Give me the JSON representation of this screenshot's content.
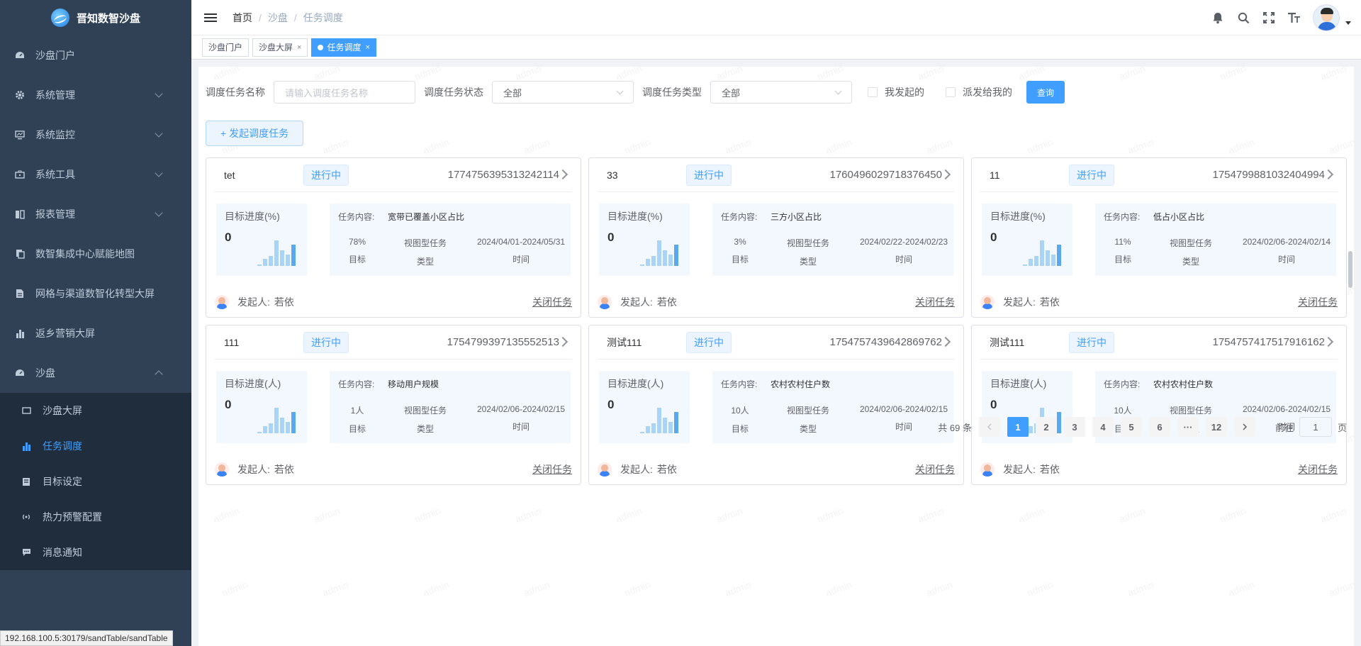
{
  "app": {
    "title": "晋知数智沙盘"
  },
  "sidebar": {
    "items": [
      {
        "label": "沙盘门户",
        "icon": "dashboard-icon",
        "expandable": false
      },
      {
        "label": "系统管理",
        "icon": "gear-icon",
        "expandable": true
      },
      {
        "label": "系统监控",
        "icon": "monitor-icon",
        "expandable": true
      },
      {
        "label": "系统工具",
        "icon": "toolbox-icon",
        "expandable": true
      },
      {
        "label": "报表管理",
        "icon": "book-icon",
        "expandable": true
      },
      {
        "label": "数智集成中心赋能地图",
        "icon": "clipboard-icon",
        "expandable": false
      },
      {
        "label": "网格与渠道数智化转型大屏",
        "icon": "document-icon",
        "expandable": false
      },
      {
        "label": "返乡营销大屏",
        "icon": "bar-chart-icon",
        "expandable": false
      },
      {
        "label": "沙盘",
        "icon": "dashboard-icon",
        "expandable": true,
        "open": true
      }
    ],
    "sub_items": [
      {
        "label": "沙盘大屏",
        "icon": "screen-icon",
        "active": false
      },
      {
        "label": "任务调度",
        "icon": "bar-chart-icon",
        "active": true
      },
      {
        "label": "目标设定",
        "icon": "target-doc-icon",
        "active": false
      },
      {
        "label": "热力预警配置",
        "icon": "broadcast-icon",
        "active": false
      },
      {
        "label": "消息通知",
        "icon": "chat-icon",
        "active": false
      }
    ]
  },
  "header": {
    "breadcrumb": [
      "首页",
      "沙盘",
      "任务调度"
    ],
    "icons": [
      "bell-icon",
      "search-icon",
      "fullscreen-icon",
      "font-size-icon"
    ]
  },
  "tags": [
    {
      "label": "沙盘门户",
      "closable": false,
      "active": false
    },
    {
      "label": "沙盘大屏",
      "closable": true,
      "active": false
    },
    {
      "label": "任务调度",
      "closable": true,
      "active": true
    }
  ],
  "filters": {
    "name_label": "调度任务名称",
    "name_placeholder": "请输入调度任务名称",
    "status_label": "调度任务状态",
    "status_value": "全部",
    "type_label": "调度任务类型",
    "type_value": "全部",
    "check_mine": "我发起的",
    "check_assigned": "派发给我的",
    "query_button": "查询"
  },
  "create_button": "+ 发起调度任务",
  "card_labels": {
    "content_key": "任务内容:",
    "target_key": "目标",
    "type_key": "类型",
    "time_key": "时间",
    "initiator_prefix": "发起人:",
    "close_task": "关闭任务"
  },
  "cards": [
    {
      "name": "tet",
      "status": "进行中",
      "id": "1774756395313242114",
      "progress_label": "目标进度(%)",
      "progress": "0",
      "content": "宽带已覆盖小区占比",
      "target": "78%",
      "type": "视图型任务",
      "time": "2024/04/01-2024/05/31",
      "initiator": "若依"
    },
    {
      "name": "33",
      "status": "进行中",
      "id": "1760496029718376450",
      "progress_label": "目标进度(%)",
      "progress": "0",
      "content": "三方小区占比",
      "target": "3%",
      "type": "视图型任务",
      "time": "2024/02/22-2024/02/23",
      "initiator": "若依"
    },
    {
      "name": "11",
      "status": "进行中",
      "id": "1754799881032404994",
      "progress_label": "目标进度(%)",
      "progress": "0",
      "content": "低占小区占比",
      "target": "11%",
      "type": "视图型任务",
      "time": "2024/02/06-2024/02/14",
      "initiator": "若依"
    },
    {
      "name": "111",
      "status": "进行中",
      "id": "1754799397135552513",
      "progress_label": "目标进度(人)",
      "progress": "0",
      "content": "移动用户规模",
      "target": "1人",
      "type": "视图型任务",
      "time": "2024/02/06-2024/02/15",
      "initiator": "若依"
    },
    {
      "name": "测试111",
      "status": "进行中",
      "id": "1754757439642869762",
      "progress_label": "目标进度(人)",
      "progress": "0",
      "content": "农村农村住户数",
      "target": "10人",
      "type": "视图型任务",
      "time": "2024/02/06-2024/02/15",
      "initiator": "若依"
    },
    {
      "name": "测试111",
      "status": "进行中",
      "id": "1754757417517916162",
      "progress_label": "目标进度(人)",
      "progress": "0",
      "content": "农村农村住户数",
      "target": "10人",
      "type": "视图型任务",
      "time": "2024/02/06-2024/02/15",
      "initiator": "若依"
    }
  ],
  "pagination": {
    "total_text": "共 69 条",
    "pages": [
      "1",
      "2",
      "3",
      "4",
      "5",
      "6",
      "···",
      "12"
    ],
    "current": "1",
    "goto_prefix": "前往",
    "goto_value": "1",
    "goto_suffix": "页"
  },
  "watermark_text": "admin",
  "status_url": "192.168.100.5:30179/sandTable/sandTable",
  "colors": {
    "sidebar_bg": "#304156",
    "submenu_bg": "#1f2d3d",
    "primary": "#409eff"
  }
}
